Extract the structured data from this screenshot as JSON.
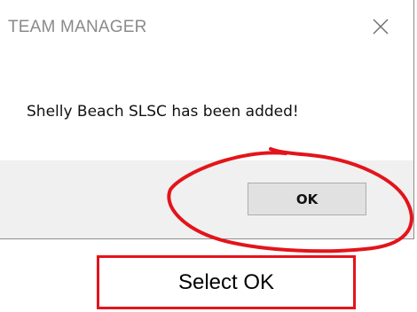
{
  "dialog": {
    "title": "TEAM MANAGER",
    "message": "Shelly Beach SLSC has been added!",
    "ok_label": "OK",
    "close_icon": "close-icon"
  },
  "annotation": {
    "caption": "Select OK",
    "highlight_color": "#e3141b"
  }
}
